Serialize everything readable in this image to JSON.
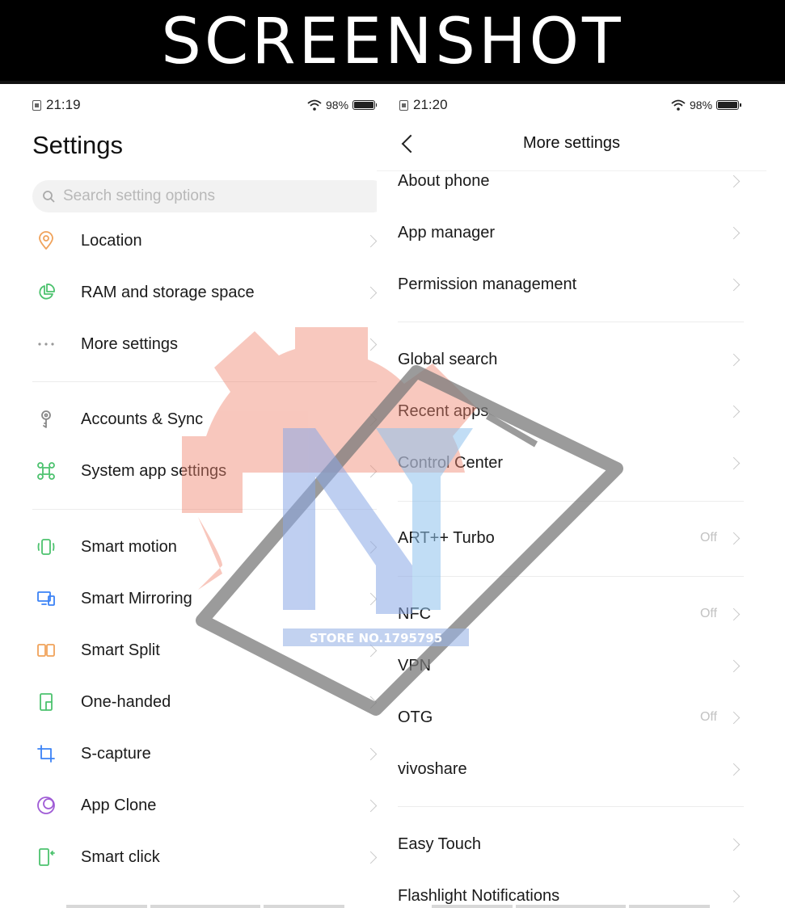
{
  "banner": {
    "title": "SCREENSHOT"
  },
  "left": {
    "status": {
      "time": "21:19",
      "battery": "98%"
    },
    "title": "Settings",
    "search_placeholder": "Search setting options",
    "items": [
      {
        "label": "Location",
        "icon": "location-pin-icon",
        "color": "#f0a25a"
      },
      {
        "label": "RAM and storage space",
        "icon": "pie-chart-icon",
        "color": "#4cc26e"
      },
      {
        "label": "More settings",
        "icon": "more-dots-icon",
        "color": "#999999"
      },
      {
        "label": "Accounts & Sync",
        "icon": "key-icon",
        "color": "#888888"
      },
      {
        "label": "System app settings",
        "icon": "command-icon",
        "color": "#4cc26e"
      },
      {
        "label": "Smart motion",
        "icon": "phone-motion-icon",
        "color": "#4cc26e"
      },
      {
        "label": "Smart Mirroring",
        "icon": "screen-mirroring-icon",
        "color": "#3b82f6"
      },
      {
        "label": "Smart Split",
        "icon": "split-screen-icon",
        "color": "#f0a25a"
      },
      {
        "label": "One-handed",
        "icon": "one-handed-icon",
        "color": "#4cc26e"
      },
      {
        "label": "S-capture",
        "icon": "crop-icon",
        "color": "#3b82f6"
      },
      {
        "label": "App Clone",
        "icon": "app-clone-icon",
        "color": "#a05cd6"
      },
      {
        "label": "Smart click",
        "icon": "smart-click-icon",
        "color": "#4cc26e"
      }
    ]
  },
  "right": {
    "status": {
      "time": "21:20",
      "battery": "98%"
    },
    "title": "More settings",
    "items": [
      {
        "label": "About phone",
        "value": ""
      },
      {
        "label": "App manager",
        "value": ""
      },
      {
        "label": "Permission management",
        "value": ""
      },
      {
        "label": "Global search",
        "value": ""
      },
      {
        "label": "Recent apps",
        "value": ""
      },
      {
        "label": "Control Center",
        "value": ""
      },
      {
        "label": "ART++ Turbo",
        "value": "Off"
      },
      {
        "label": "NFC",
        "value": "Off"
      },
      {
        "label": "VPN",
        "value": ""
      },
      {
        "label": "OTG",
        "value": "Off"
      },
      {
        "label": "vivoshare",
        "value": ""
      },
      {
        "label": "Easy Touch",
        "value": ""
      },
      {
        "label": "Flashlight Notifications",
        "value": ""
      }
    ]
  },
  "watermark": {
    "text": "STORE NO.1795795"
  }
}
